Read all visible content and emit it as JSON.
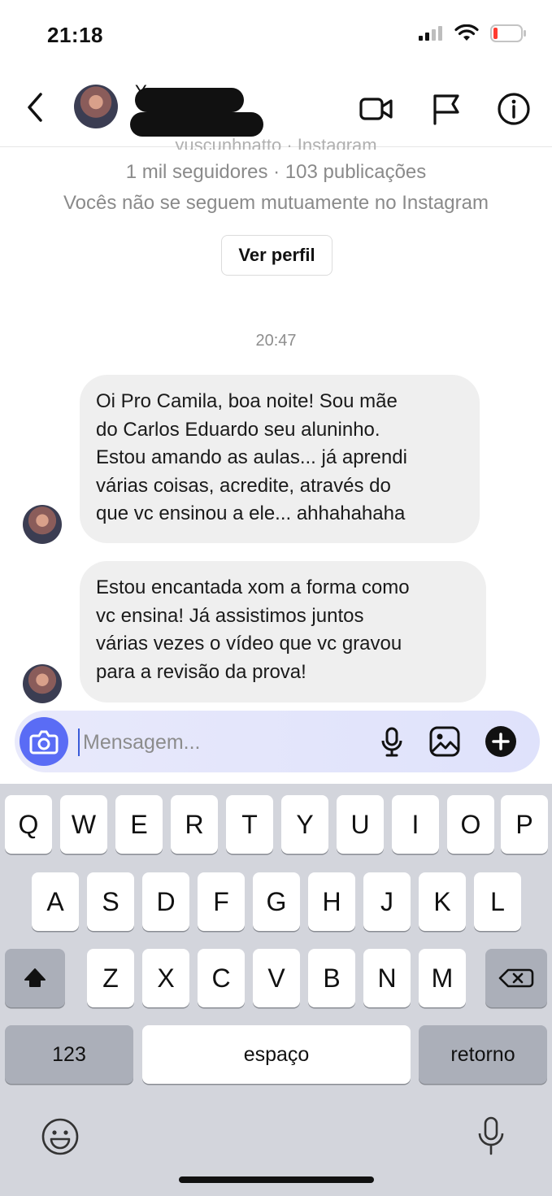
{
  "status_bar": {
    "time": "21:18"
  },
  "header": {
    "name_peek": "Y"
  },
  "profile": {
    "peek_line": "yuscunhnatto · Instagram",
    "followers": "1 mil seguidores · 103 publicações",
    "mutual": "Vocês não se seguem mutuamente no Instagram",
    "view_profile_label": "Ver perfil"
  },
  "thread": {
    "timestamp": "20:47",
    "messages": [
      {
        "text": "Oi Pro Camila, boa noite! Sou mãe\ndo Carlos Eduardo seu aluninho.\nEstou amando as aulas... já aprendi\nvárias coisas, acredite, através do\nque vc ensinou a ele... ahhahahaha"
      },
      {
        "text": "Estou encantada xom a forma como\nvc ensina! Já assistimos juntos\nvárias vezes o vídeo que vc gravou\npara a revisão da prova!"
      }
    ]
  },
  "composer": {
    "placeholder": "Mensagem..."
  },
  "keyboard": {
    "row1": [
      "Q",
      "W",
      "E",
      "R",
      "T",
      "Y",
      "U",
      "I",
      "O",
      "P"
    ],
    "row2": [
      "A",
      "S",
      "D",
      "F",
      "G",
      "H",
      "J",
      "K",
      "L"
    ],
    "row3": [
      "Z",
      "X",
      "C",
      "V",
      "B",
      "N",
      "M"
    ],
    "numbers_label": "123",
    "space_label": "espaço",
    "return_label": "retorno"
  },
  "colors": {
    "accent": "#5a6cf5",
    "bubble": "#efefef",
    "keyboard_bg": "#d3d5dc"
  },
  "icons": [
    "back-icon",
    "video-call-icon",
    "flag-icon",
    "info-icon",
    "camera-icon",
    "microphone-icon",
    "gallery-icon",
    "add-icon",
    "shift-icon",
    "backspace-icon",
    "emoji-icon",
    "dictation-icon"
  ]
}
